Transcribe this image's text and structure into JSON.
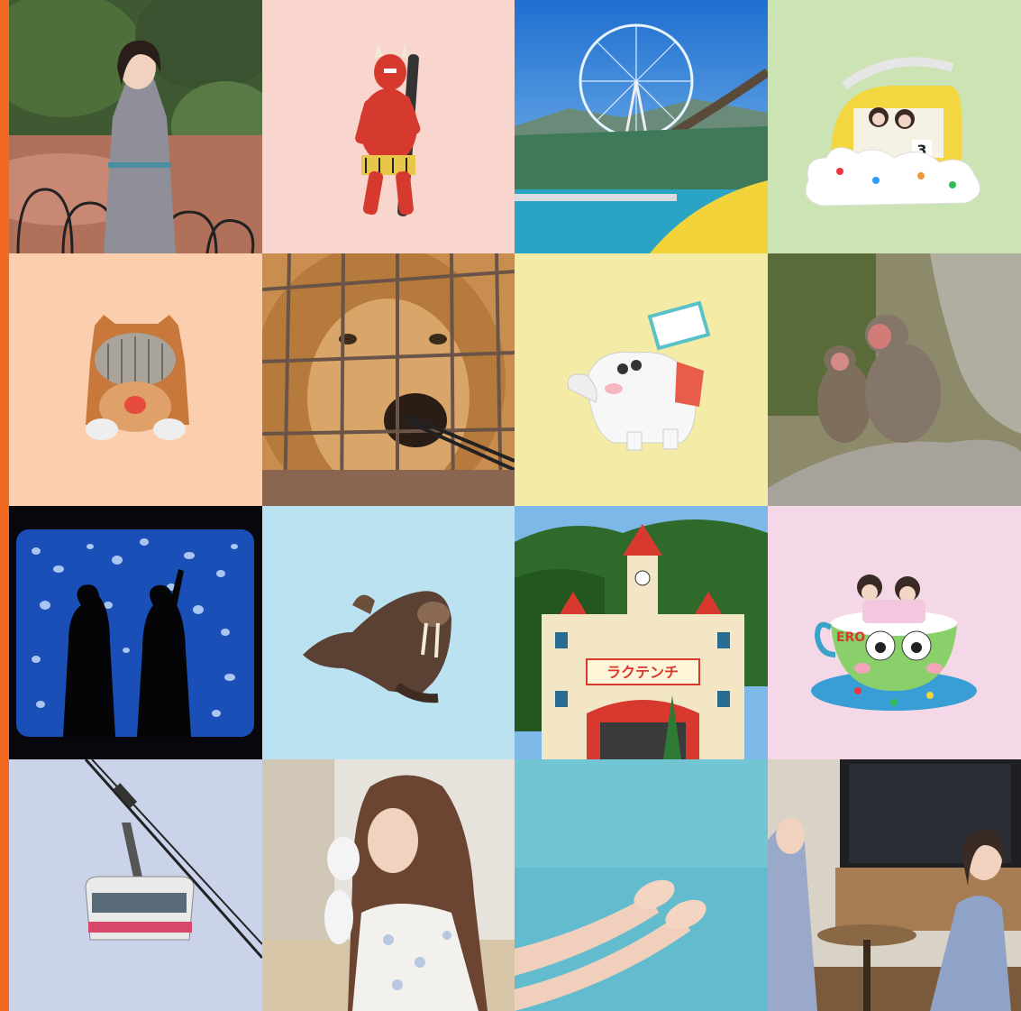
{
  "colors": {
    "accent_bar": "#F26A21",
    "tile_backgrounds": {
      "oni": "#F8D6CE",
      "cloud_ride": "#CCE3B4",
      "lion_ride": "#FBCFAE",
      "elephant_ride": "#F4ECA6",
      "walrus": "#BBE2F0",
      "keroppi_cup": "#F5D8E8",
      "ropeway": "#CAD3EA"
    }
  },
  "tiles": [
    {
      "id": "woman-hot-spring",
      "icon": "photo-woman-red-hot-spring"
    },
    {
      "id": "red-oni-statue",
      "icon": "red-oni-figure-icon"
    },
    {
      "id": "ferris-wheel-park",
      "icon": "photo-ferris-wheel-coaster"
    },
    {
      "id": "cloud-car-ride",
      "icon": "cloud-car-ride-icon",
      "car_number": "3"
    },
    {
      "id": "lion-ride",
      "icon": "lion-ride-icon"
    },
    {
      "id": "lion-feeding",
      "icon": "photo-lion-behind-fence"
    },
    {
      "id": "elephant-ride",
      "icon": "flying-elephant-ride-icon"
    },
    {
      "id": "snow-monkeys",
      "icon": "photo-monkeys-on-rock"
    },
    {
      "id": "jellyfish-aquarium",
      "icon": "photo-jellyfish-silhouettes"
    },
    {
      "id": "walrus",
      "icon": "walrus-icon"
    },
    {
      "id": "castle-gate",
      "icon": "photo-castle-gate",
      "sign_text": "ラクテンチ"
    },
    {
      "id": "keroppi-cup",
      "icon": "keroppi-cup-ride-icon",
      "cup_text": "ERO"
    },
    {
      "id": "ropeway",
      "icon": "ropeway-gondola-icon"
    },
    {
      "id": "woman-workshop",
      "icon": "photo-woman-gloves"
    },
    {
      "id": "hands-in-water",
      "icon": "photo-hands-water"
    },
    {
      "id": "hotel-room",
      "icon": "photo-women-hotel-room"
    }
  ]
}
